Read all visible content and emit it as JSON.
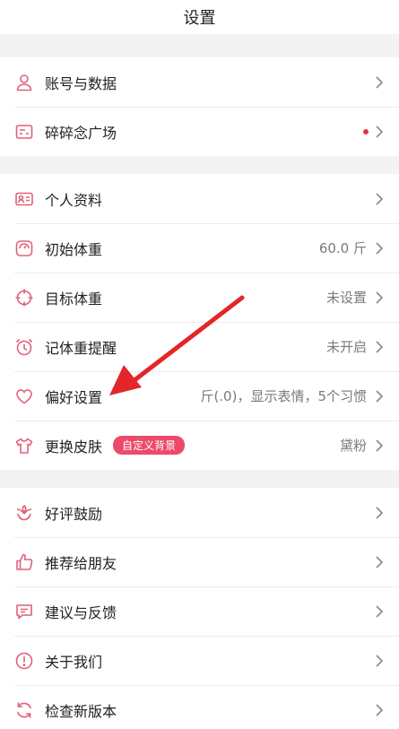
{
  "header": {
    "title": "设置"
  },
  "groups": [
    {
      "items": [
        {
          "label": "账号与数据",
          "value": "",
          "icon": "user-icon"
        },
        {
          "label": "碎碎念广场",
          "value": "",
          "icon": "chat-card-icon",
          "has_dot": true
        }
      ]
    },
    {
      "items": [
        {
          "label": "个人资料",
          "value": "",
          "icon": "id-card-icon"
        },
        {
          "label": "初始体重",
          "value": "60.0 斤",
          "icon": "scale-icon"
        },
        {
          "label": "目标体重",
          "value": "未设置",
          "icon": "target-icon"
        },
        {
          "label": "记体重提醒",
          "value": "未开启",
          "icon": "alarm-icon"
        },
        {
          "label": "偏好设置",
          "value": "斤(.0)，显示表情，5个习惯",
          "icon": "heart-icon"
        },
        {
          "label": "更换皮肤",
          "value": "黛粉",
          "icon": "shirt-icon",
          "badge": "自定义背景"
        }
      ]
    },
    {
      "items": [
        {
          "label": "好评鼓励",
          "value": "",
          "icon": "flower-icon"
        },
        {
          "label": "推荐给朋友",
          "value": "",
          "icon": "thumbs-up-icon"
        },
        {
          "label": "建议与反馈",
          "value": "",
          "icon": "message-icon"
        },
        {
          "label": "关于我们",
          "value": "",
          "icon": "info-icon"
        },
        {
          "label": "检查新版本",
          "value": "",
          "icon": "refresh-icon"
        }
      ]
    }
  ],
  "colors": {
    "accent": "#ec4a6a",
    "icon": "#e0607a",
    "dot": "#e8334a",
    "annotation_arrow": "#e3262b"
  }
}
